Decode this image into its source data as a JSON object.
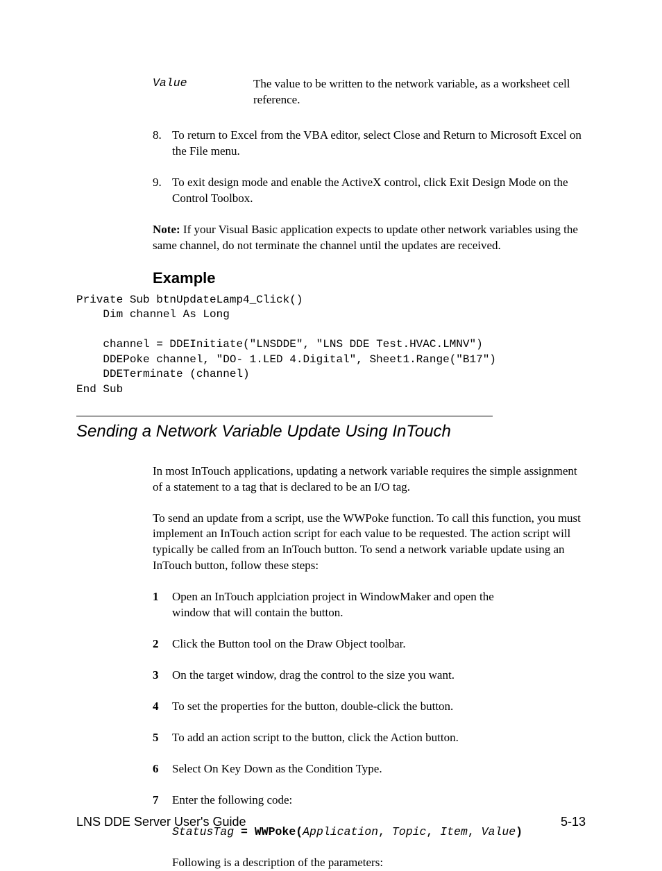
{
  "param": {
    "term": "Value",
    "desc": "The value to be written to the network variable, as a worksheet cell reference."
  },
  "steps_a": [
    {
      "n": "8.",
      "text": "To return to Excel from the VBA editor, select Close and Return to Microsoft Excel on the File menu."
    },
    {
      "n": "9.",
      "text": "To exit design mode and enable the ActiveX control, click Exit Design Mode on the Control Toolbox."
    }
  ],
  "note": {
    "label": "Note:",
    "text": " If your Visual Basic application expects to update other network variables using the same channel, do not terminate the channel until the updates are received."
  },
  "example_heading": "Example",
  "code": "Private Sub btnUpdateLamp4_Click()\n    Dim channel As Long\n\n    channel = DDEInitiate(\"LNSDDE\", \"LNS DDE Test.HVAC.LMNV\")\n    DDEPoke channel, \"DO- 1.LED 4.Digital\", Sheet1.Range(\"B17\")\n    DDETerminate (channel)\nEnd Sub",
  "section_heading": "Sending a Network Variable Update Using InTouch",
  "intro1": "In most InTouch applications, updating a network variable requires the simple assignment of a statement to a tag that is declared to be an I/O tag.",
  "intro2": "To send an update from a script, use the WWPoke function.  To call this function, you must implement an InTouch action script for each value to be requested.  The action script will typically be called from an InTouch button.  To send a network variable update using an InTouch button, follow these steps:",
  "steps_b": [
    {
      "n": "1",
      "text": "Open an InTouch applciation project in WindowMaker and open the window that will contain the button."
    },
    {
      "n": "2",
      "text": "Click the Button tool on the Draw Object toolbar."
    },
    {
      "n": "3",
      "text": "On the target window, drag the control to the size you want."
    },
    {
      "n": "4",
      "text": "To set the properties for the button, double-click the button."
    },
    {
      "n": "5",
      "text": "To add an action script to the button, click the Action button."
    },
    {
      "n": "6",
      "text": "Select On Key Down as the Condition Type."
    },
    {
      "n": "7",
      "text": "Enter the following code:"
    }
  ],
  "wwpoke": {
    "status": "StatusTag",
    "eq": " = ",
    "fn": "WWPoke(",
    "app": "Application",
    "c1": ", ",
    "topic": "Topic",
    "c2": ", ",
    "item": "Item",
    "c3": ", ",
    "value": "Value",
    "close": ")"
  },
  "following": "Following is a description of the parameters:",
  "footer": {
    "left": "LNS DDE Server User's Guide",
    "right": "5-13"
  }
}
